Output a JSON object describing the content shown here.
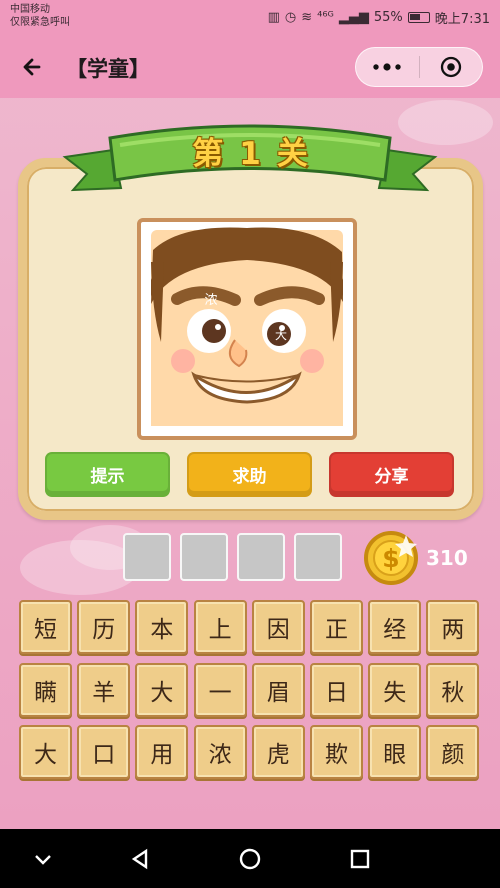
{
  "status": {
    "carrier_line1": "中国移动",
    "carrier_line2": "仅限紧急呼叫",
    "network": "⁴⁶ᴳ",
    "battery_percent": "55%",
    "time": "晚上7:31"
  },
  "nav": {
    "title": "【学童】"
  },
  "level": {
    "prefix": "第",
    "number": "1",
    "suffix": "关"
  },
  "picture": {
    "eyebrow_char": "浓",
    "eye_char": "大"
  },
  "buttons": {
    "hint": "提示",
    "help": "求助",
    "share": "分享"
  },
  "coins": "310",
  "answer_slot_count": 4,
  "char_grid": [
    [
      "短",
      "历",
      "本",
      "上",
      "因",
      "正",
      "经",
      "两"
    ],
    [
      "瞒",
      "羊",
      "大",
      "一",
      "眉",
      "日",
      "失",
      "秋"
    ],
    [
      "大",
      "口",
      "用",
      "浓",
      "虎",
      "欺",
      "眼",
      "颜"
    ]
  ],
  "colors": {
    "background": "#ec9fc0",
    "hint": "#78c941",
    "help": "#f2b21a",
    "share": "#e33f35",
    "tile": "#efcd8a",
    "banner": "#79c546"
  }
}
